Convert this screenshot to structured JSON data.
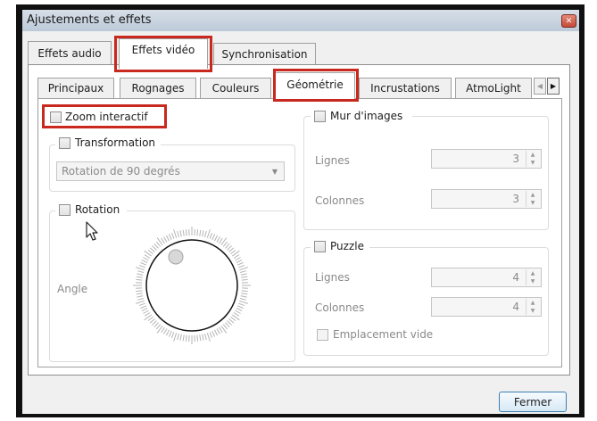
{
  "window": {
    "title": "Ajustements et effets",
    "close_glyph": "✕"
  },
  "main_tabs": [
    {
      "label": "Effets audio",
      "active": false
    },
    {
      "label": "Effets vidéo",
      "active": true
    },
    {
      "label": "Synchronisation",
      "active": false
    }
  ],
  "sub_tabs": [
    {
      "label": "Principaux",
      "active": false
    },
    {
      "label": "Rognages",
      "active": false
    },
    {
      "label": "Couleurs",
      "active": false
    },
    {
      "label": "Géométrie",
      "active": true
    },
    {
      "label": "Incrustations",
      "active": false
    },
    {
      "label": "AtmoLight",
      "active": false
    }
  ],
  "tab_scroll": {
    "left_glyph": "◀",
    "right_glyph": "▶"
  },
  "geometry": {
    "zoom": {
      "label": "Zoom interactif",
      "checked": false
    },
    "transformation": {
      "label": "Transformation",
      "checked": false,
      "selected": "Rotation de 90 degrés"
    },
    "rotation": {
      "label": "Rotation",
      "checked": false,
      "angle_label": "Angle"
    },
    "wall": {
      "label": "Mur d'images",
      "checked": false,
      "rows_label": "Lignes",
      "rows_value": "3",
      "cols_label": "Colonnes",
      "cols_value": "3"
    },
    "puzzle": {
      "label": "Puzzle",
      "checked": false,
      "rows_label": "Lignes",
      "rows_value": "4",
      "cols_label": "Colonnes",
      "cols_value": "4",
      "empty_label": "Emplacement vide",
      "empty_checked": false
    }
  },
  "footer": {
    "close_label": "Fermer"
  },
  "highlight_color": "#c8281e"
}
